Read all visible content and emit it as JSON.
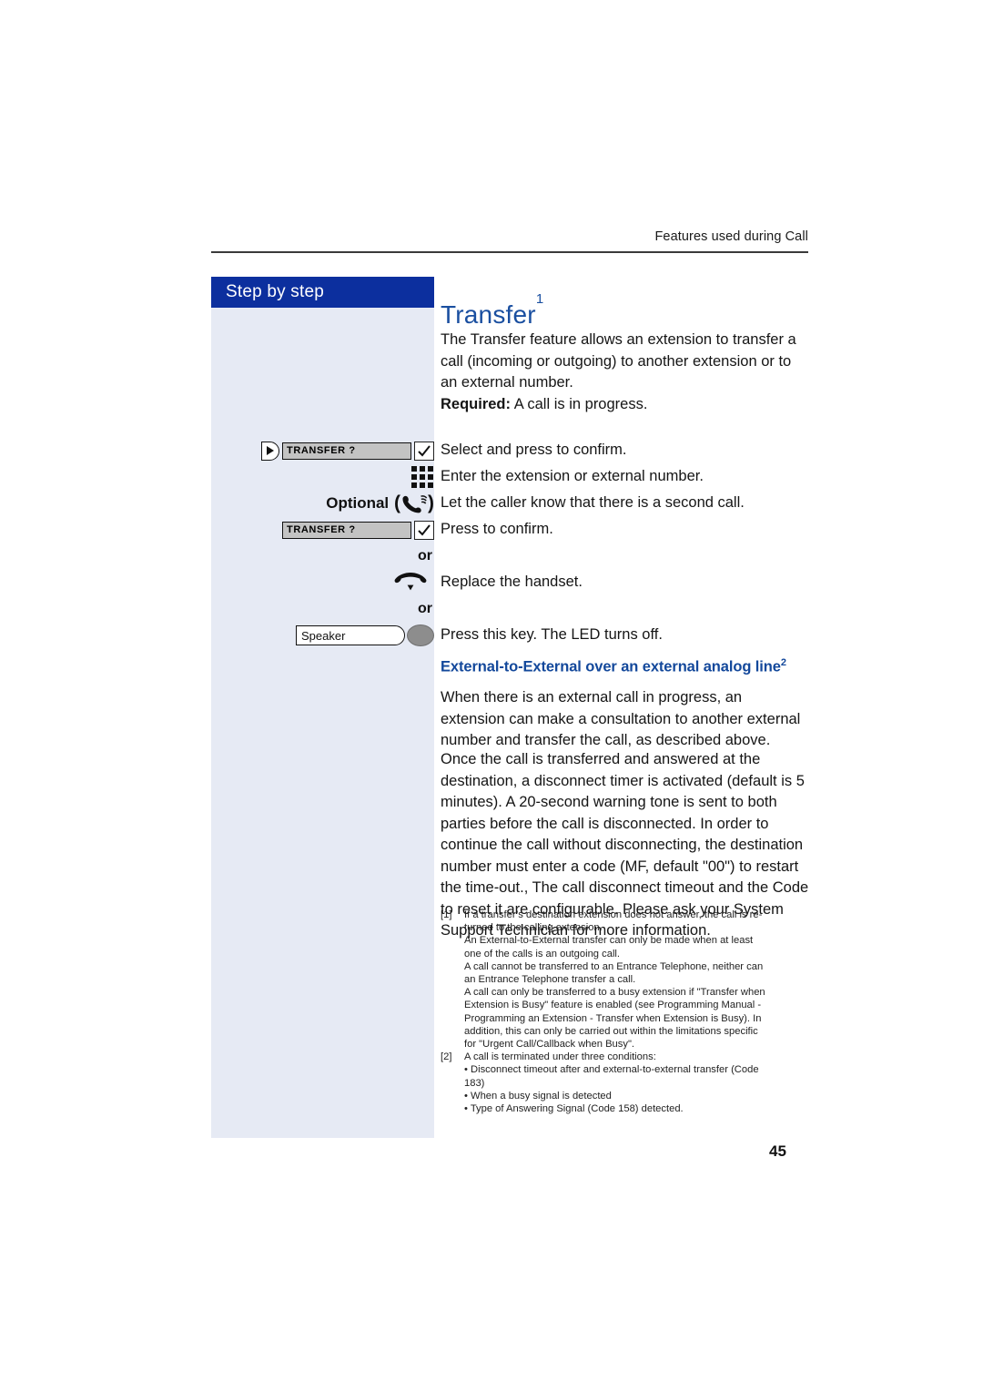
{
  "header": {
    "running_head": "Features used during Call"
  },
  "sidebar": {
    "title": "Step by step",
    "bg_color": "#e6eaf4",
    "header_color": "#0c2f9e"
  },
  "main": {
    "title": "Transfer",
    "title_footnote": "1",
    "title_color": "#1a4fa0",
    "intro": "The Transfer feature allows an extension to transfer a call (incoming or outgoing) to another extension or to an external number.",
    "required_label": "Required:",
    "required_text": " A call is in progress.",
    "subhead": "External-to-External over an external analog line",
    "subhead_footnote": "2",
    "subhead_color": "#13489b",
    "para_2": "When there is an external call in progress, an extension can make a consultation to another external number and transfer the call, as described above.",
    "para_3": "Once the call is transferred and answered at the destination, a disconnect timer is activated (default is 5 minutes). A 20-second warning tone is sent to both parties before the call is disconnected. In order to continue the call without disconnecting, the destination number must enter a code (MF, default \"00\") to restart the time-out., The call disconnect timeout and the Code to reset it are configurable. Please ask your System Support Technician for more information."
  },
  "steps": [
    {
      "icon": "display-bar-select",
      "display_text": "TRANSFER ?",
      "description": "Select and press to confirm."
    },
    {
      "icon": "keypad-icon",
      "description": "Enter the extension or external number."
    },
    {
      "icon": "handset-ring-icon",
      "optional_label": "Optional",
      "description": "Let the caller know that there is a second call."
    },
    {
      "icon": "display-bar",
      "display_text": "TRANSFER ?",
      "description": "Press to confirm."
    },
    {
      "icon": "or-separator",
      "or_label": "or"
    },
    {
      "icon": "hangup-handset-icon",
      "description": "Replace the handset."
    },
    {
      "icon": "or-separator",
      "or_label": "or"
    },
    {
      "icon": "speaker-key",
      "speaker_label": "Speaker",
      "description": "Press this key. The LED turns off."
    }
  ],
  "footnotes": [
    {
      "marker": "[1]",
      "lines": [
        "If a transfer’s destination extension does not answer, the call is re-",
        "turned to the calling extension.",
        "An External-to-External transfer can only be made when at least",
        "one of the calls is an outgoing call.",
        "A call cannot be transferred to an Entrance Telephone, neither can",
        "an Entrance Telephone transfer a call.",
        "A call can only be transferred to a busy extension if \"Transfer when",
        "Extension is Busy\" feature is enabled (see Programming Manual -",
        "Programming an Extension - Transfer when Extension is Busy). In",
        "addition, this can only be carried out within the limitations specific",
        "for \"Urgent Call/Callback when Busy\"."
      ]
    },
    {
      "marker": "[2]",
      "lines": [
        "A call is terminated under three conditions:",
        "• Disconnect timeout after and external-to-external transfer (Code",
        "183)",
        "• When a busy signal is detected",
        "• Type of Answering Signal (Code 158) detected."
      ]
    }
  ],
  "folio": "45"
}
